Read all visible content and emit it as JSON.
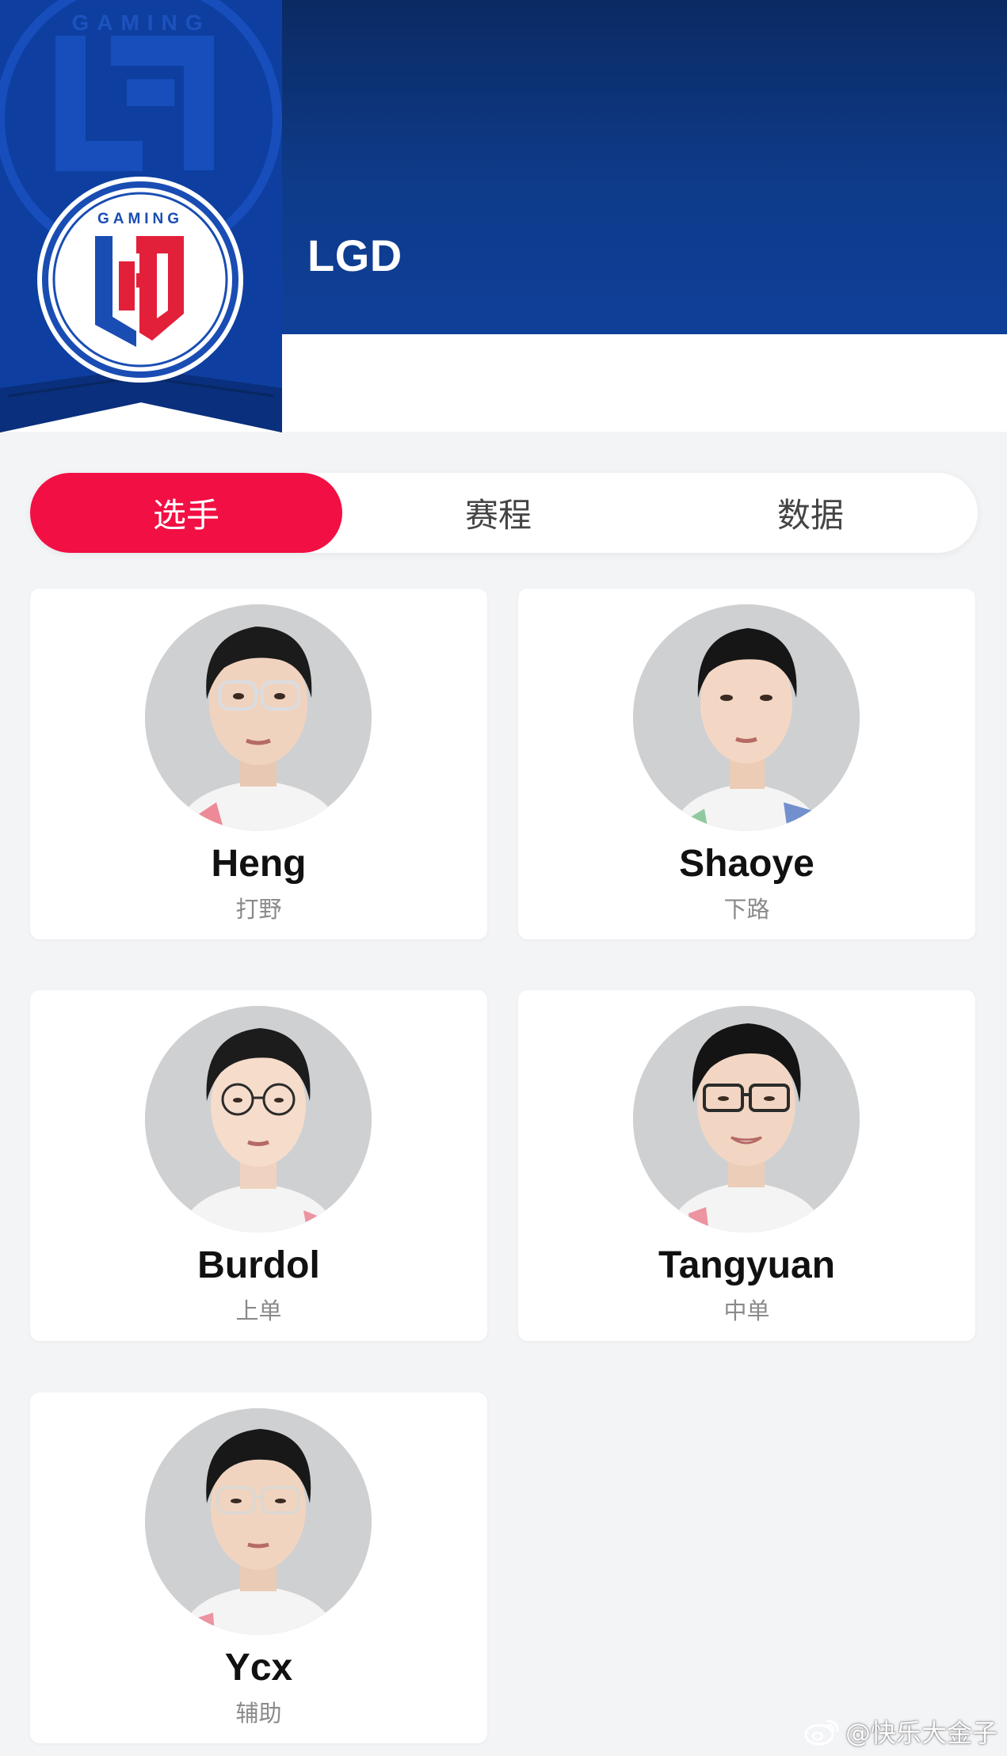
{
  "team": {
    "name": "LGD",
    "logo_text": "GAMING"
  },
  "tabs": [
    {
      "label": "选手",
      "active": true
    },
    {
      "label": "赛程",
      "active": false
    },
    {
      "label": "数据",
      "active": false
    }
  ],
  "players": [
    {
      "name": "Heng",
      "role": "打野"
    },
    {
      "name": "Shaoye",
      "role": "下路"
    },
    {
      "name": "Burdol",
      "role": "上单"
    },
    {
      "name": "Tangyuan",
      "role": "中单"
    },
    {
      "name": "Ycx",
      "role": "辅助"
    }
  ],
  "watermark": "@快乐大金子",
  "colors": {
    "header_blue": "#0e3b8a",
    "accent_red": "#f20f44",
    "logo_red": "#e3203a",
    "logo_blue": "#1a4db3"
  }
}
